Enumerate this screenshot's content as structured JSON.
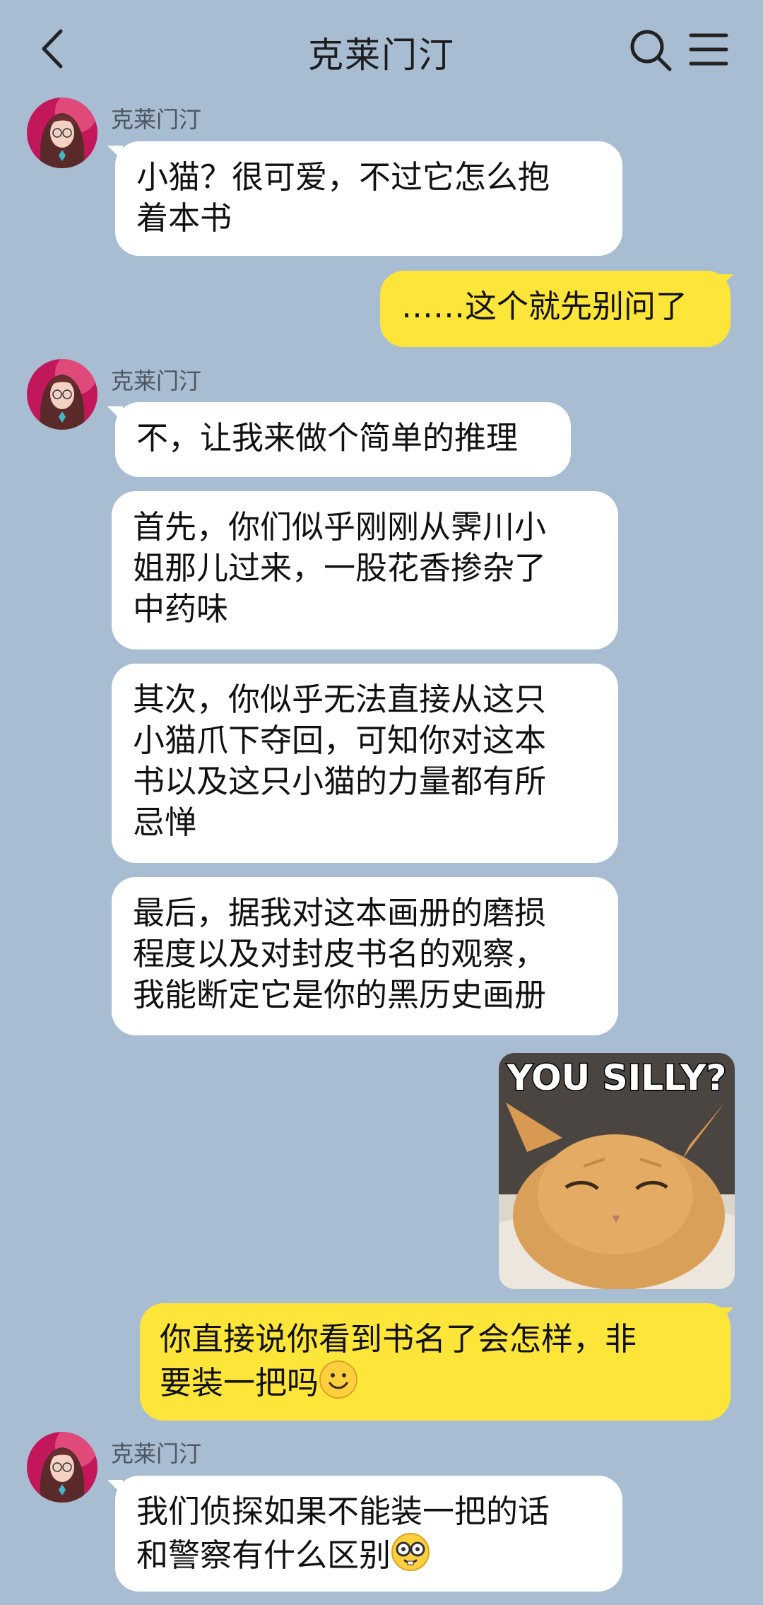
{
  "header": {
    "title": "克莱门汀",
    "icons": [
      "back-arrow-icon",
      "search-icon",
      "menu-icon"
    ]
  },
  "messages": [
    {
      "sender": "克莱门汀",
      "direction": "incoming",
      "text": "小猫？很可爱，不过它怎么抱\n着本书"
    },
    {
      "direction": "outgoing",
      "text": "……这个就先别问了"
    },
    {
      "sender": "克莱门汀",
      "direction": "incoming",
      "text": "不，让我来做个简单的推理"
    },
    {
      "direction": "incoming",
      "text": "首先，你们似乎刚刚从霁川小\n姐那儿过来，一股花香掺杂了\n中药味"
    },
    {
      "direction": "incoming",
      "text": "其次，你似乎无法直接从这只\n小猫爪下夺回，可知你对这本\n书以及这只小猫的力量都有所\n忌惮"
    },
    {
      "direction": "incoming",
      "text": "最后，据我对这本画册的磨损\n程度以及对封皮书名的观察，\n我能断定它是你的黑历史画册"
    },
    {
      "direction": "outgoing",
      "type": "image",
      "caption": "YOU SILLY?"
    },
    {
      "direction": "outgoing",
      "text": "你直接说你看到书名了会怎样，非\n要装一把吗",
      "emoji": "smiling-face-icon"
    },
    {
      "sender": "克莱门汀",
      "direction": "incoming",
      "text": "我们侦探如果不能装一把的话\n和警察有什么区别",
      "emoji": "nerd-face-icon"
    }
  ],
  "colors": {
    "background": "#a8bdd2",
    "incoming_bubble": "#ffffff",
    "outgoing_bubble": "#fde639"
  }
}
